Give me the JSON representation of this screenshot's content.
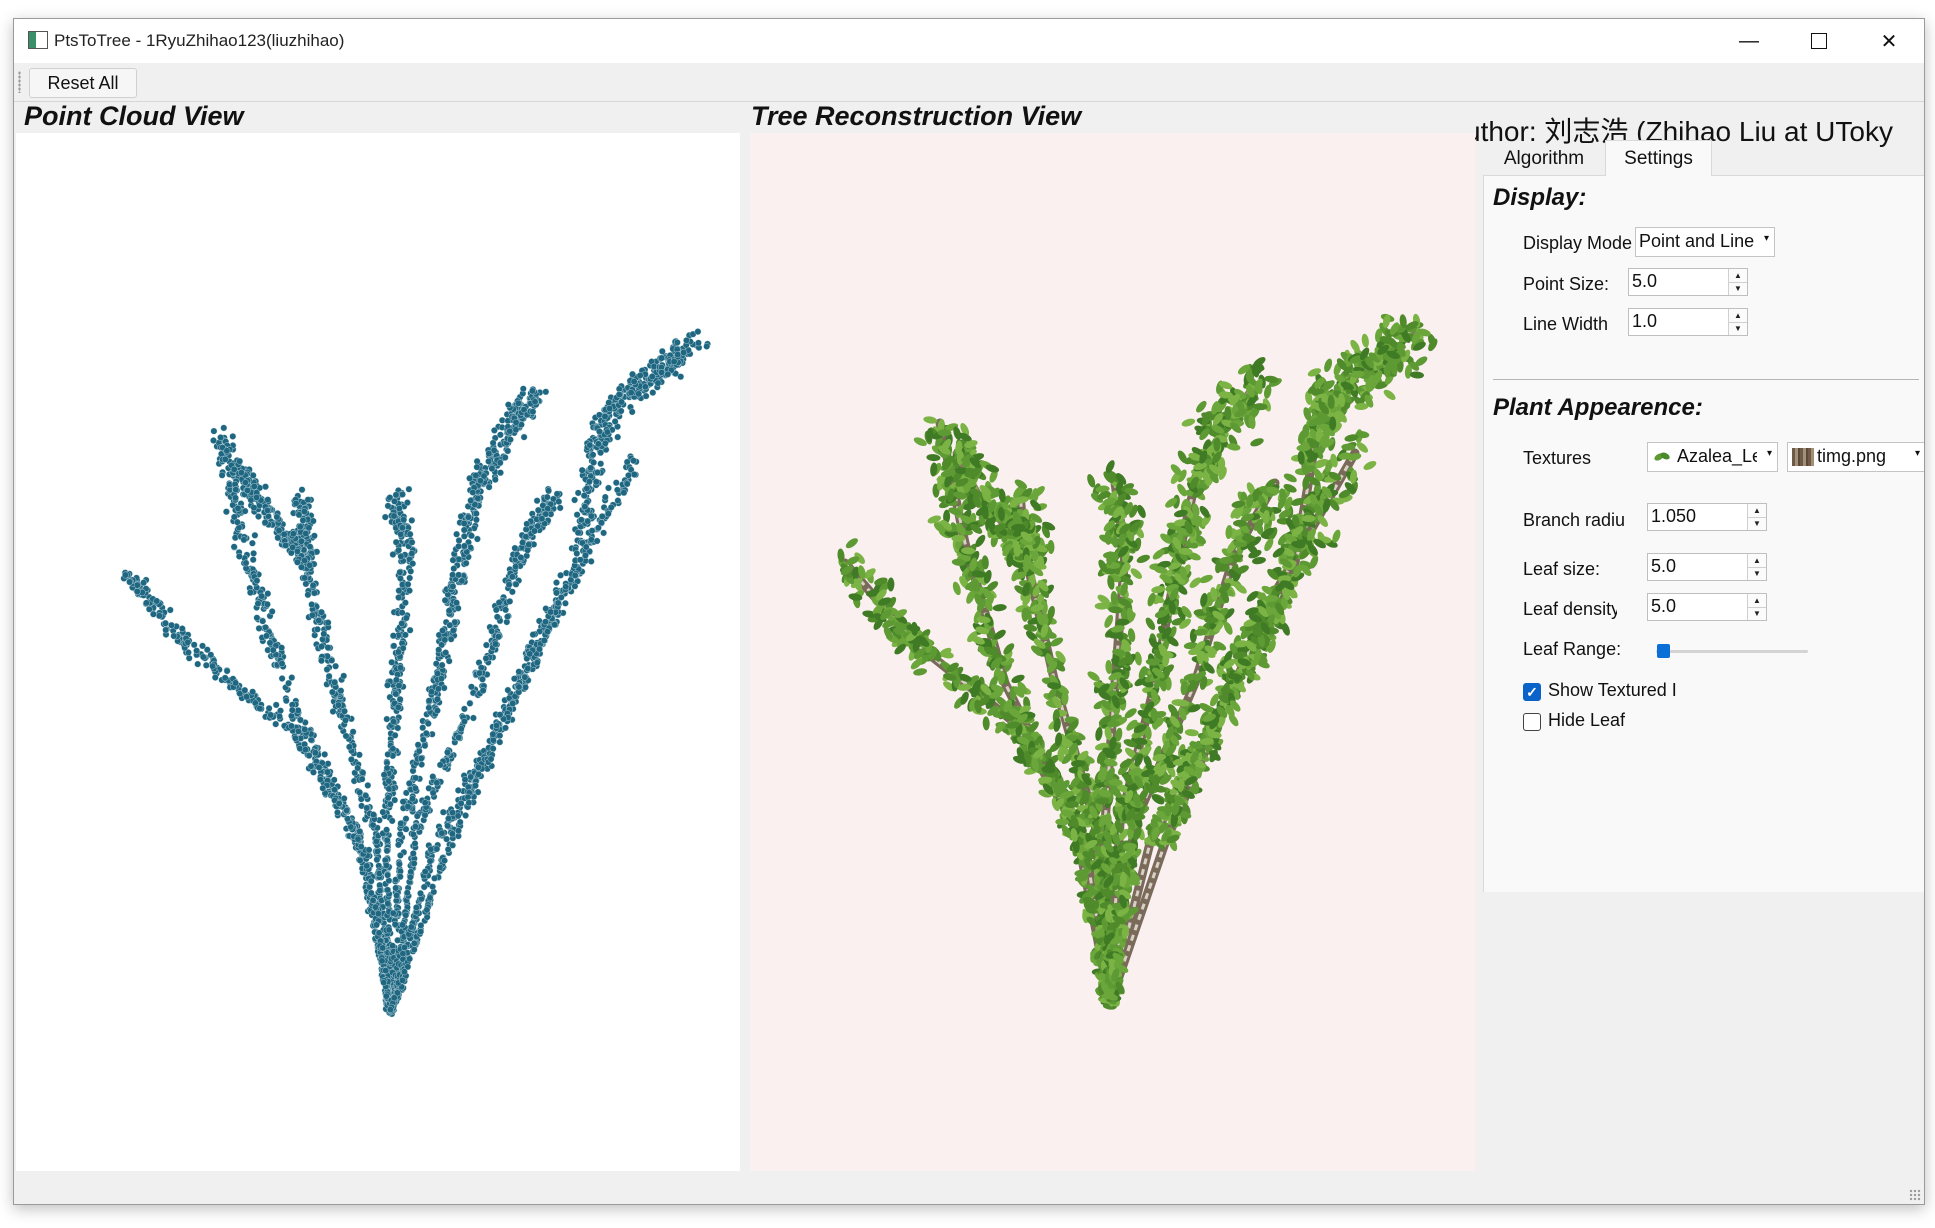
{
  "window": {
    "title": "PtsToTree - 1RyuZhihao123(liuzhihao)",
    "controls": {
      "minimize": "—",
      "maximize": "☐",
      "close": "✕"
    }
  },
  "toolbar": {
    "reset_label": "Reset All"
  },
  "views": {
    "point_cloud": {
      "title": "Point Cloud View",
      "background": "#ffffff",
      "point_color": "#1f6680"
    },
    "reconstruction": {
      "title": "Tree Reconstruction View",
      "background": "#fbf0f0"
    }
  },
  "panel": {
    "author": "uthor: 刘志浩 (Zhihao Liu at UToky",
    "tabs": [
      {
        "label": "Algorithm"
      },
      {
        "label": "Settings"
      }
    ],
    "active_tab": "Settings",
    "display": {
      "title": "Display:",
      "display_mode_label": "Display Mode",
      "display_mode_value": "Point and Line",
      "point_size_label": "Point Size:",
      "point_size_value": "5.0",
      "line_width_label": "Line Width",
      "line_width_value": "1.0"
    },
    "plant": {
      "title": "Plant Appearence:",
      "textures_label": "Textures",
      "leaf_texture_value": "Azalea_Leaf",
      "bark_texture_value": "timg.png",
      "branch_radius_label": "Branch radius",
      "branch_radius_value": "1.050",
      "leaf_size_label": "Leaf size:",
      "leaf_size_value": "5.0",
      "leaf_density_label": "Leaf density",
      "leaf_density_value": "5.0",
      "leaf_range_label": "Leaf Range:",
      "leaf_range_fraction": 0.02,
      "show_textured_label": "Show Textured I",
      "show_textured_checked": true,
      "hide_leaf_label": "Hide Leaf",
      "hide_leaf_checked": false
    }
  },
  "colors": {
    "accent": "#0a63c9",
    "leaf": "#5e9a34",
    "bark": "#8b7a68"
  },
  "icons": {
    "app": "window-app-icon",
    "leaf_texture": "leaf-icon",
    "bark_texture": "bark-icon"
  }
}
